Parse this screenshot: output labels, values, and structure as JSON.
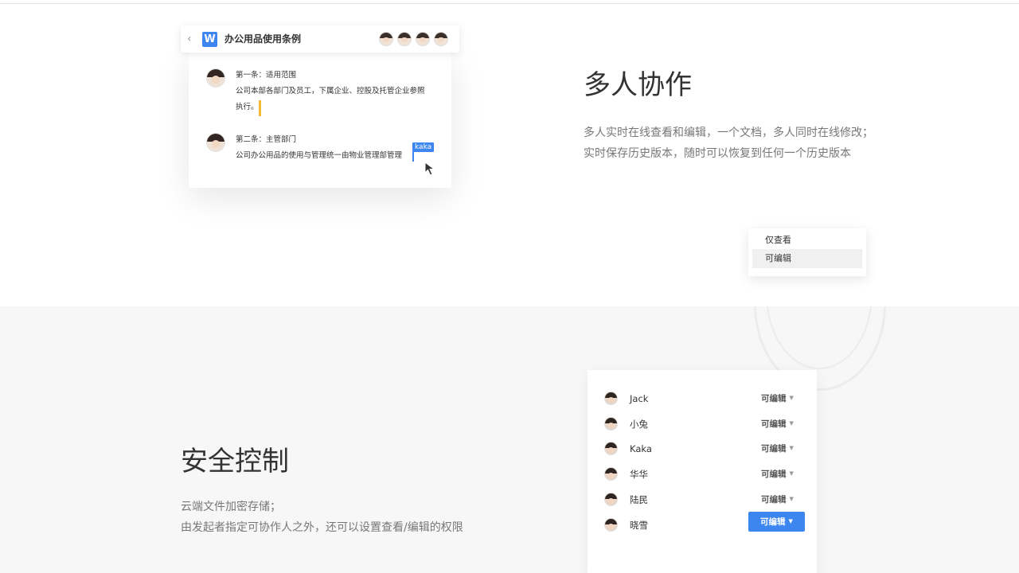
{
  "collab_section": {
    "doc": {
      "title": "办公用品使用条例",
      "comments": [
        {
          "heading": "第一条：适用范围",
          "lines": [
            "公司本部各部门及员工，下属企业、控股及托管企业参照",
            "执行。"
          ]
        },
        {
          "heading": "第二条：主管部门",
          "lines": [
            "公司办公用品的使用与管理统一由物业管理部管理"
          ]
        }
      ],
      "cursor_tag": "kaka"
    },
    "title": "多人协作",
    "desc_lines": [
      "多人实时在线查看和编辑，一个文档，多人同时在线修改；",
      "实时保存历史版本，随时可以恢复到任何一个历史版本"
    ]
  },
  "security_section": {
    "title": "安全控制",
    "desc_lines": [
      "云端文件加密存储；",
      "由发起者指定可协作人之外，还可以设置查看/编辑的权限"
    ],
    "members": [
      {
        "name": "Jack",
        "role": "可编辑"
      },
      {
        "name": "小兔",
        "role": "可编辑"
      },
      {
        "name": "Kaka",
        "role": "可编辑"
      },
      {
        "name": "华华",
        "role": "可编辑"
      },
      {
        "name": "陆民",
        "role": "可编辑"
      },
      {
        "name": "晓雪",
        "role": "可编辑"
      }
    ],
    "dropdown_options": [
      "仅查看",
      "可编辑"
    ]
  },
  "colors": {
    "accent": "#3d86f0",
    "cursor_yellow": "#f3b935",
    "section_bg": "#f7f7f7"
  }
}
